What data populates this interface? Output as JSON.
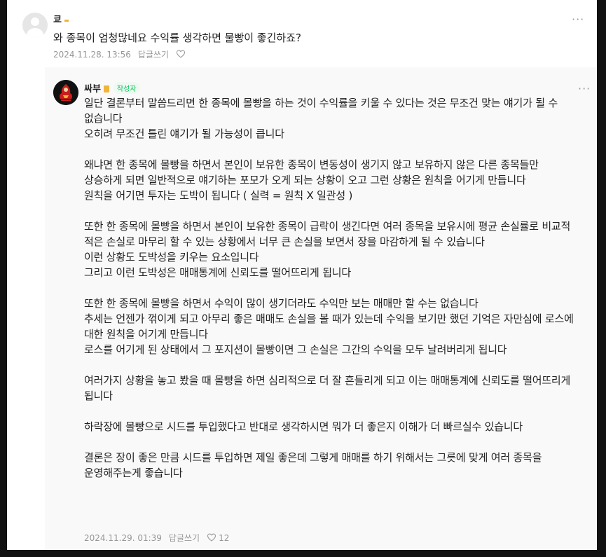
{
  "comment": {
    "author": "쿄",
    "text": "와 종목이 엄청많네요 수익률 생각하면 물빵이 좋긴하죠?",
    "date": "2024.11.28. 13:56",
    "reply_label": "답글쓰기",
    "more": "···"
  },
  "reply": {
    "author": "싸부",
    "author_badge": "작성자",
    "paragraphs": [
      "일단 결론부터 말씀드리면 한 종목에 몰빵을 하는 것이 수익률을 키울 수 있다는 것은 무조건 맞는 얘기가 될 수 없습니다",
      "오히려 무조건 틀린 얘기가 될 가능성이 큽니다",
      "",
      "왜냐면 한 종목에 몰빵을 하면서 본인이 보유한 종목이 변동성이 생기지 않고 보유하지 않은 다른 종목들만 상승하게 되면 일반적으로 얘기하는 포모가 오게 되는 상황이 오고 그런 상황은 원칙을 어기게 만듭니다",
      "원칙을 어기면 투자는 도박이 됩니다 ( 실력 = 원칙 X 일관성 )",
      "",
      "또한 한 종목에 몰빵을 하면서 본인이 보유한 종목이 급락이 생긴다면 여러 종목을 보유시에 평균 손실률로 비교적 적은 손실로 마무리 할 수 있는 상황에서 너무 큰 손실을 보면서 장을 마감하게 될 수 있습니다",
      "이런 상황도 도박성을 키우는 요소입니다",
      "그리고 이런 도박성은 매매통계에 신뢰도를 떨어뜨리게 됩니다",
      "",
      "또한 한 종목에 몰빵을 하면서 수익이 많이 생기더라도 수익만 보는 매매만 할 수는 없습니다",
      "추세는 언젠가 꺾이게 되고 아무리 좋은 매매도 손실을 볼 때가 있는데 수익을 보기만 했던 기억은 자만심에 로스에 대한 원칙을 어기게 만듭니다",
      "로스를 어기게 된 상태에서 그 포지션이 몰빵이면 그 손실은 그간의 수익을 모두 날려버리게 됩니다",
      "",
      "여러가지 상황을 놓고 봤을 때 몰빵을 하면 심리적으로 더 잘 흔들리게 되고 이는 매매통계에 신뢰도를 떨어뜨리게 됩니다",
      "",
      "하락장에 몰빵으로 시드를 투입했다고 반대로 생각하시면 뭐가 더 좋은지 이해가 더 빠르실수 있습니다",
      "",
      "결론은 장이 좋은 만큼 시드를 투입하면 제일 좋은데 그렇게 매매를 하기 위해서는 그릇에 맞게 여러 종목을 운영해주는게 좋습니다"
    ],
    "date": "2024.11.29. 01:39",
    "reply_label": "답글쓰기",
    "like_count": "12",
    "more": "···"
  },
  "icons": {
    "comment_more": "more-dots-icon",
    "heart": "heart-outline-icon"
  },
  "colors": {
    "background": "#111111",
    "panel": "#ffffff",
    "reply_bg": "#f9f9fa",
    "meta_text": "#979797",
    "author_badge": "#03c75a",
    "level_badge": "#f0b43c"
  }
}
